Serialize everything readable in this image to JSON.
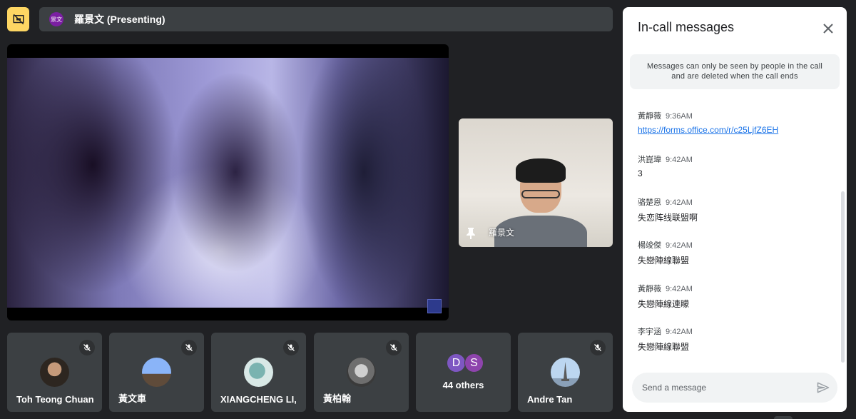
{
  "presenting": {
    "avatar_text": "景文",
    "label": "羅景文 (Presenting)"
  },
  "pinned": {
    "name": "羅景文"
  },
  "participants": [
    {
      "name": "Toh Teong Chuan",
      "muted": true
    },
    {
      "name": "黃文車",
      "muted": true
    },
    {
      "name": "XIANGCHENG LI,",
      "muted": true
    },
    {
      "name": "黃柏翰",
      "muted": true
    },
    {
      "name": "Andre Tan",
      "muted": true
    }
  ],
  "others": {
    "avatars": [
      "D",
      "S"
    ],
    "label": "44 others"
  },
  "chat": {
    "title": "In-call messages",
    "notice": "Messages can only be seen by people in the call and are deleted when the call ends",
    "messages": [
      {
        "sender": "黃靜薇",
        "time": "9:36AM",
        "text": "https://forms.office.com/r/c25LjfZ6EH"
      },
      {
        "sender": "洪崑瑋",
        "time": "9:42AM",
        "text": "3"
      },
      {
        "sender": "骆楚恩",
        "time": "9:42AM",
        "text": "失恋阵线联盟啊"
      },
      {
        "sender": "楊竣傑",
        "time": "9:42AM",
        "text": "失戀陣線聯盟"
      },
      {
        "sender": "黃靜薇",
        "time": "9:42AM",
        "text": "失戀陣線連矇"
      },
      {
        "sender": "李宇涵",
        "time": "9:42AM",
        "text": "失戀陣線聯盟"
      }
    ],
    "input_placeholder": "Send a message"
  },
  "colors": {
    "background": "#202124",
    "present_accent": "#fdd663",
    "link": "#1a73e8"
  }
}
